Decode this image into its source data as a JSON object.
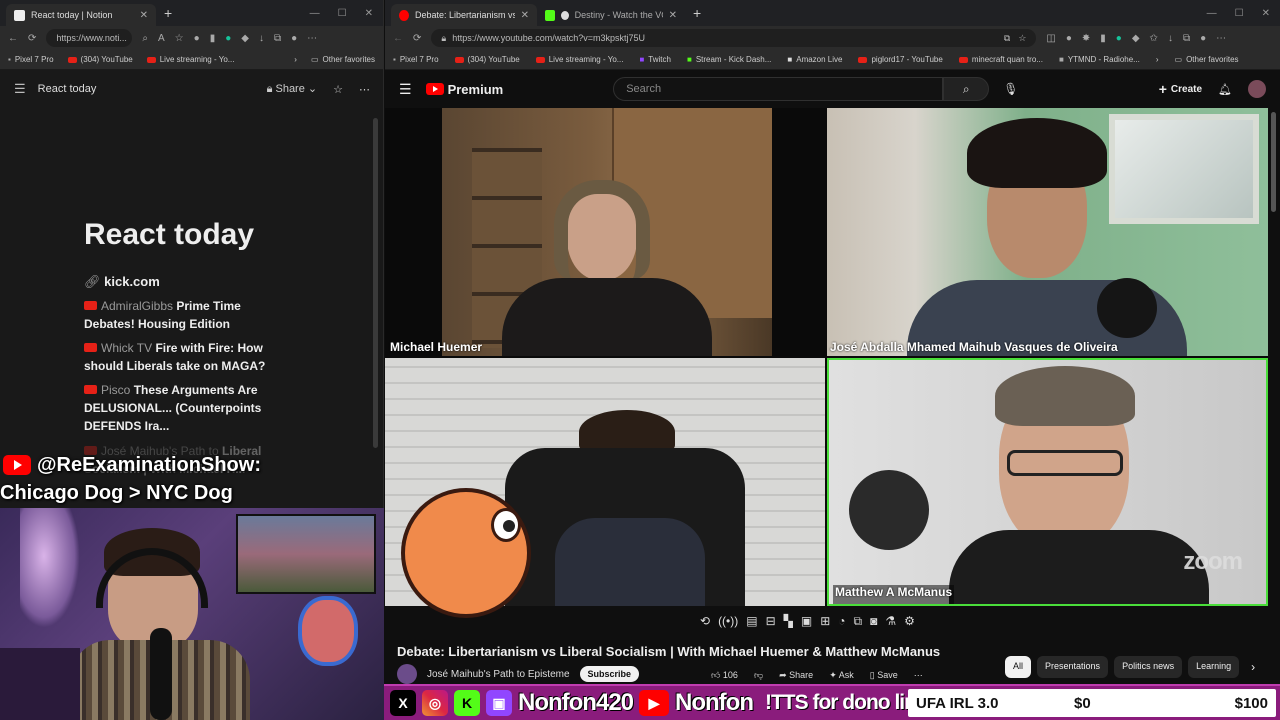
{
  "left_browser": {
    "tabs": [
      {
        "label": "React today | Notion",
        "active": true
      }
    ],
    "url": "https://www.noti...",
    "favorites": [
      "Pixel 7 Pro",
      "(304) YouTube",
      "Live streaming - Yo..."
    ],
    "other_favorites": "Other favorites"
  },
  "notion": {
    "page_name": "React today",
    "share_label": "Share",
    "title": "React today",
    "link": "kick.com",
    "items": [
      {
        "channel": "AdmiralGibbs",
        "title": "Prime Time Debates! Housing Edition"
      },
      {
        "channel": "Whick TV",
        "title": "Fire with Fire: How should Liberals take on MAGA?"
      },
      {
        "channel": "Pisco",
        "title": "These Arguments Are DELUSIONAL... (Counterpoints DEFENDS Ira..."
      },
      {
        "channel": "José Maihub's Path to",
        "title": "Liberal Socialism | With Michael H..."
      }
    ]
  },
  "overlay": {
    "handle": "@ReExaminationShow:",
    "message": "Chicago Dog > NYC Dog"
  },
  "right_browser": {
    "tabs": [
      {
        "label": "Debate: Libertarianism vs Liberal S",
        "active": true
      },
      {
        "label": "Destiny - Watch the VOD on K",
        "active": false
      }
    ],
    "url": "https://www.youtube.com/watch?v=m3kpsktj75U",
    "favorites": [
      "Pixel 7 Pro",
      "(304) YouTube",
      "Live streaming - Yo...",
      "Twitch",
      "Stream - Kick Dash...",
      "Amazon Live",
      "piglord17 - YouTube",
      "minecraft quan tro...",
      "YTMND - Radiohe..."
    ],
    "other_favorites": "Other favorites"
  },
  "youtube": {
    "logo_text": "Premium",
    "search_placeholder": "Search",
    "create_label": "Create",
    "participants": [
      "Michael Huemer",
      "José Abdalla Mhamed Maihub Vasques de Oliveira",
      "",
      "Matthew A McManus"
    ],
    "zoom_watermark": "zoom",
    "video_title": "Debate: Libertarianism vs Liberal Socialism | With Michael Huemer & Matthew McManus",
    "channel": "José Maihub's Path to Episteme",
    "subscribe_label": "Subscribe",
    "actions": {
      "likes": "106",
      "share": "Share",
      "ask": "Ask",
      "save": "Save"
    },
    "chips": [
      "All",
      "Presentations",
      "Politics news",
      "Learning"
    ]
  },
  "stream_bar": {
    "handle": "Nonfon420",
    "handle2": "Nonfon",
    "tts": "!TTS for dono link",
    "goal_name": "UFA IRL 3.0",
    "goal_current": "$0",
    "goal_target": "$100"
  },
  "colors": {
    "youtube_red": "#ff0000",
    "stream_bar": "#8a1c7c",
    "speaker_highlight": "#4ade3a"
  }
}
